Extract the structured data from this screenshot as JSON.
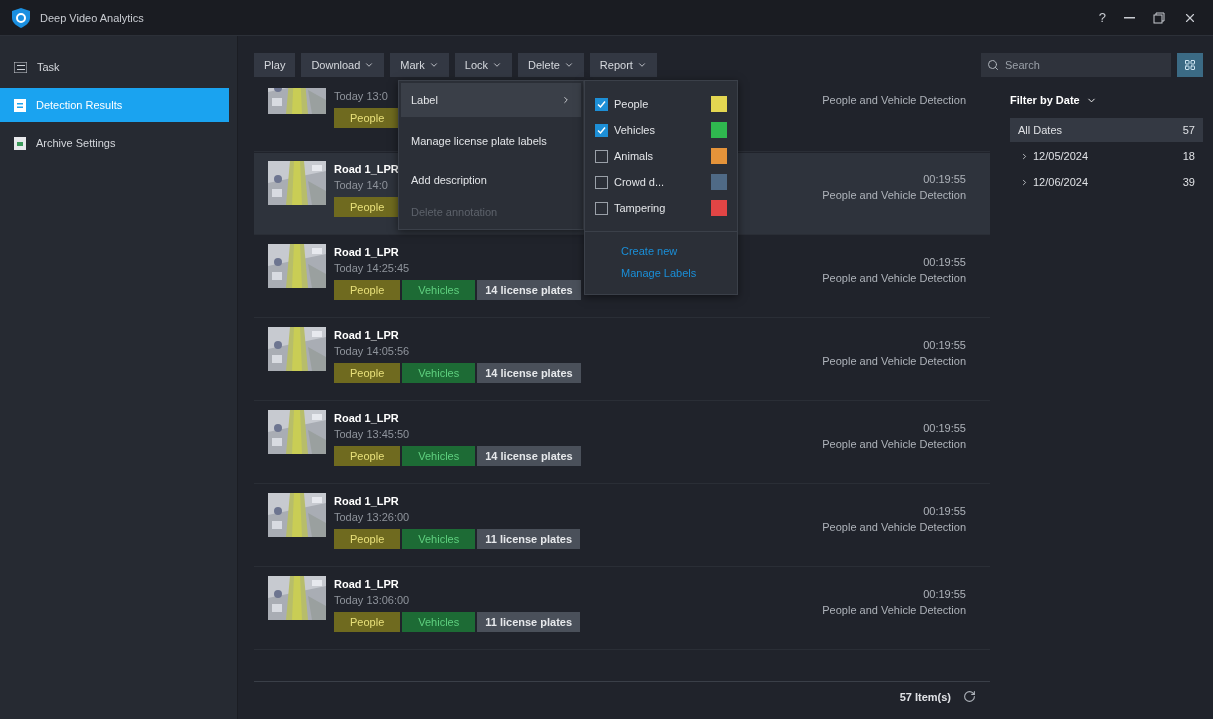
{
  "window": {
    "title": "Deep Video Analytics",
    "help": "?"
  },
  "sidebar": {
    "items": [
      {
        "label": "Task",
        "kind": "task",
        "selected": false
      },
      {
        "label": "Detection Results",
        "kind": "results",
        "selected": true
      },
      {
        "label": "Archive Settings",
        "kind": "archive",
        "selected": false
      }
    ]
  },
  "toolbar": [
    {
      "label": "Play",
      "dropdown": false
    },
    {
      "label": "Download",
      "dropdown": true
    },
    {
      "label": "Mark",
      "dropdown": true
    },
    {
      "label": "Lock",
      "dropdown": true
    },
    {
      "label": "Delete",
      "dropdown": true
    },
    {
      "label": "Report",
      "dropdown": true
    }
  ],
  "search": {
    "placeholder": "Search"
  },
  "results": [
    {
      "time": "Today 13:0",
      "tags": [
        {
          "label": "People",
          "kind": "people"
        }
      ],
      "detection": "People and Vehicle Detection",
      "selected": false,
      "partial": true
    },
    {
      "title": "Road 1_LPR",
      "time": "Today 14:0",
      "tags": [
        {
          "label": "People",
          "kind": "people"
        }
      ],
      "duration": "00:19:55",
      "detection": "People and Vehicle Detection",
      "selected": true
    },
    {
      "title": "Road 1_LPR",
      "time": "Today 14:25:45",
      "tags": [
        {
          "label": "People",
          "kind": "people"
        },
        {
          "label": "Vehicles",
          "kind": "vehicles"
        },
        {
          "label": "14 license plates",
          "kind": "plates"
        }
      ],
      "duration": "00:19:55",
      "detection": "People and Vehicle Detection",
      "selected": false
    },
    {
      "title": "Road 1_LPR",
      "time": "Today 14:05:56",
      "tags": [
        {
          "label": "People",
          "kind": "people"
        },
        {
          "label": "Vehicles",
          "kind": "vehicles"
        },
        {
          "label": "14 license plates",
          "kind": "plates"
        }
      ],
      "duration": "00:19:55",
      "detection": "People and Vehicle Detection",
      "selected": false
    },
    {
      "title": "Road 1_LPR",
      "time": "Today 13:45:50",
      "tags": [
        {
          "label": "People",
          "kind": "people"
        },
        {
          "label": "Vehicles",
          "kind": "vehicles"
        },
        {
          "label": "14 license plates",
          "kind": "plates"
        }
      ],
      "duration": "00:19:55",
      "detection": "People and Vehicle Detection",
      "selected": false
    },
    {
      "title": "Road 1_LPR",
      "time": "Today 13:26:00",
      "tags": [
        {
          "label": "People",
          "kind": "people"
        },
        {
          "label": "Vehicles",
          "kind": "vehicles"
        },
        {
          "label": "11 license plates",
          "kind": "plates"
        }
      ],
      "duration": "00:19:55",
      "detection": "People and Vehicle Detection",
      "selected": false
    },
    {
      "title": "Road 1_LPR",
      "time": "Today 13:06:00",
      "tags": [
        {
          "label": "People",
          "kind": "people"
        },
        {
          "label": "Vehicles",
          "kind": "vehicles"
        },
        {
          "label": "11 license plates",
          "kind": "plates"
        }
      ],
      "duration": "00:19:55",
      "detection": "People and Vehicle Detection",
      "selected": false
    }
  ],
  "footer": {
    "count": "57 Item(s)"
  },
  "context_menu": {
    "items": [
      {
        "label": "Label",
        "submenu": true,
        "selected": true,
        "disabled": false
      },
      {
        "label": "Manage license plate labels",
        "submenu": false,
        "selected": false,
        "disabled": false
      },
      {
        "label": "Add description",
        "submenu": false,
        "selected": false,
        "disabled": false
      },
      {
        "label": "Delete annotation",
        "submenu": false,
        "selected": false,
        "disabled": true
      }
    ]
  },
  "label_menu": {
    "labels": [
      {
        "label": "People",
        "checked": true,
        "color": "#e3d651"
      },
      {
        "label": "Vehicles",
        "checked": true,
        "color": "#2fb84f"
      },
      {
        "label": "Animals",
        "checked": false,
        "color": "#e4933a"
      },
      {
        "label": "Crowd d...",
        "checked": false,
        "color": "#4f6a86"
      },
      {
        "label": "Tampering",
        "checked": false,
        "color": "#e24545"
      }
    ],
    "actions": [
      "Create new",
      "Manage Labels"
    ]
  },
  "date_filter": {
    "title": "Filter by Date",
    "items": [
      {
        "label": "All Dates",
        "count": "57",
        "selected": true,
        "expandable": false
      },
      {
        "label": "12/05/2024",
        "count": "18",
        "selected": false,
        "expandable": true
      },
      {
        "label": "12/06/2024",
        "count": "39",
        "selected": false,
        "expandable": true
      }
    ]
  }
}
